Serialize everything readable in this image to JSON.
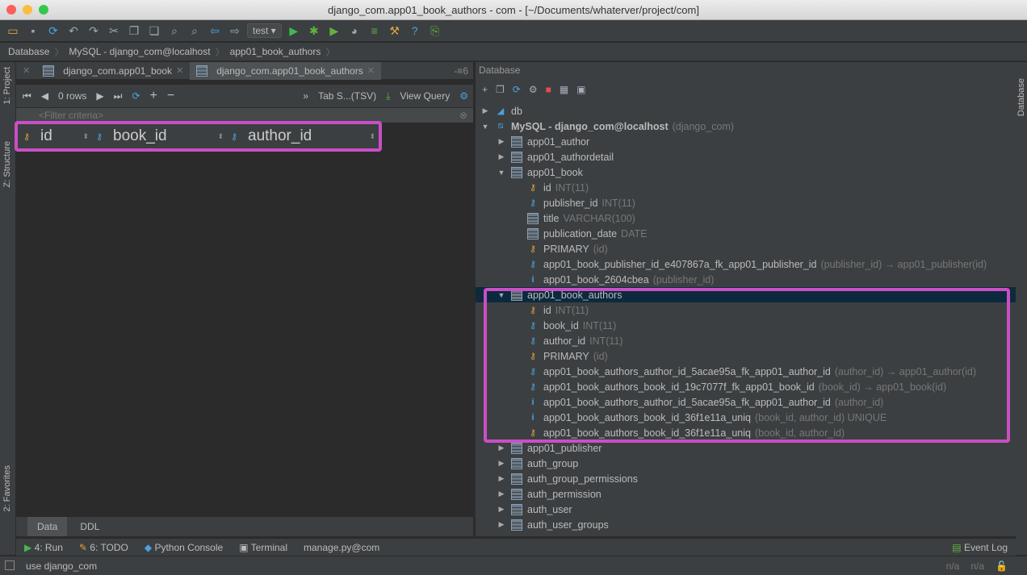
{
  "window": {
    "title": "django_com.app01_book_authors - com - [~/Documents/whaterver/project/com]"
  },
  "toolbar": {
    "run_config": "test"
  },
  "breadcrumb": [
    "Database",
    "MySQL - django_com@localhost",
    "app01_book_authors"
  ],
  "side": {
    "project": "1: Project",
    "structure": "Z: Structure",
    "favorites": "2: Favorites",
    "database": "Database"
  },
  "editor_tabs": [
    {
      "label": "django_com.app01_book",
      "active": false
    },
    {
      "label": "django_com.app01_book_authors",
      "active": true
    }
  ],
  "tab_count": "6",
  "grid": {
    "rows": "0 rows",
    "export_format": "Tab S...(TSV)",
    "view_query": "View Query",
    "filter_placeholder": "<Filter criteria>",
    "columns": [
      "id",
      "book_id",
      "author_id"
    ]
  },
  "bottom_tabs": [
    "Data",
    "DDL"
  ],
  "db_panel": {
    "title": "Database",
    "tree": [
      {
        "level": 0,
        "arrow": "right",
        "icon": "db",
        "name": "db"
      },
      {
        "level": 0,
        "arrow": "down",
        "icon": "mysql",
        "name": "MySQL - django_com@localhost",
        "detail": "(django_com)",
        "bold": true
      },
      {
        "level": 1,
        "arrow": "right",
        "icon": "table",
        "name": "app01_author"
      },
      {
        "level": 1,
        "arrow": "right",
        "icon": "table",
        "name": "app01_authordetail"
      },
      {
        "level": 1,
        "arrow": "down",
        "icon": "table",
        "name": "app01_book"
      },
      {
        "level": 2,
        "icon": "key",
        "name": "id",
        "detail": "INT(11)"
      },
      {
        "level": 2,
        "icon": "fkcol",
        "name": "publisher_id",
        "detail": "INT(11)"
      },
      {
        "level": 2,
        "icon": "col",
        "name": "title",
        "detail": "VARCHAR(100)"
      },
      {
        "level": 2,
        "icon": "col",
        "name": "publication_date",
        "detail": "DATE"
      },
      {
        "level": 2,
        "icon": "key",
        "name": "PRIMARY",
        "detail": "(id)"
      },
      {
        "level": 2,
        "icon": "fk",
        "name": "app01_book_publisher_id_e407867a_fk_app01_publisher_id",
        "detail": "(publisher_id) → app01_publisher(id)"
      },
      {
        "level": 2,
        "icon": "idx",
        "name": "app01_book_2604cbea",
        "detail": "(publisher_id)"
      },
      {
        "level": 1,
        "arrow": "down",
        "icon": "table",
        "name": "app01_book_authors",
        "selected": true
      },
      {
        "level": 2,
        "icon": "key",
        "name": "id",
        "detail": "INT(11)"
      },
      {
        "level": 2,
        "icon": "fkcol",
        "name": "book_id",
        "detail": "INT(11)"
      },
      {
        "level": 2,
        "icon": "fkcol",
        "name": "author_id",
        "detail": "INT(11)"
      },
      {
        "level": 2,
        "icon": "key",
        "name": "PRIMARY",
        "detail": "(id)"
      },
      {
        "level": 2,
        "icon": "fk",
        "name": "app01_book_authors_author_id_5acae95a_fk_app01_author_id",
        "detail": "(author_id) → app01_author(id)"
      },
      {
        "level": 2,
        "icon": "fk",
        "name": "app01_book_authors_book_id_19c7077f_fk_app01_book_id",
        "detail": "(book_id) → app01_book(id)"
      },
      {
        "level": 2,
        "icon": "idx",
        "name": "app01_book_authors_author_id_5acae95a_fk_app01_author_id",
        "detail": "(author_id)"
      },
      {
        "level": 2,
        "icon": "idx",
        "name": "app01_book_authors_book_id_36f1e11a_uniq",
        "detail": "(book_id, author_id) UNIQUE"
      },
      {
        "level": 2,
        "icon": "key",
        "name": "app01_book_authors_book_id_36f1e11a_uniq",
        "detail": "(book_id, author_id)"
      },
      {
        "level": 1,
        "arrow": "right",
        "icon": "table",
        "name": "app01_publisher"
      },
      {
        "level": 1,
        "arrow": "right",
        "icon": "table",
        "name": "auth_group"
      },
      {
        "level": 1,
        "arrow": "right",
        "icon": "table",
        "name": "auth_group_permissions"
      },
      {
        "level": 1,
        "arrow": "right",
        "icon": "table",
        "name": "auth_permission"
      },
      {
        "level": 1,
        "arrow": "right",
        "icon": "table",
        "name": "auth_user"
      },
      {
        "level": 1,
        "arrow": "right",
        "icon": "table",
        "name": "auth_user_groups"
      }
    ]
  },
  "tool_windows": [
    "4: Run",
    "6: TODO",
    "Python Console",
    "Terminal",
    "manage.py@com"
  ],
  "event_log": "Event Log",
  "status": {
    "message": "use django_com",
    "pos1": "n/a",
    "pos2": "n/a"
  },
  "colors": {
    "highlight": "#c94fc5",
    "selection": "#0d293e"
  }
}
